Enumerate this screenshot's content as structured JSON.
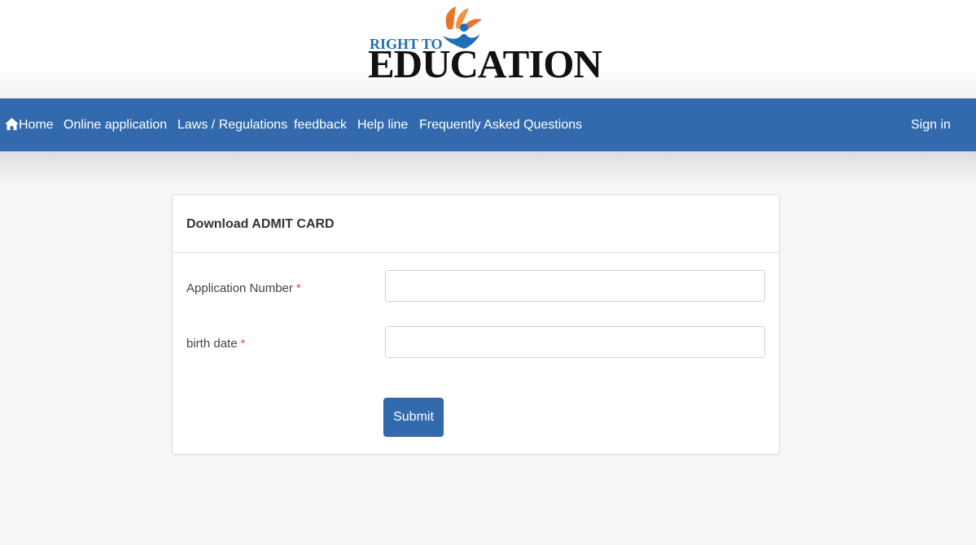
{
  "logo": {
    "line1": "RIGHT TO",
    "line2": "EDUCATION",
    "colors": {
      "blue": "#1f6fb8",
      "orange": "#e8742a",
      "black": "#111111"
    }
  },
  "nav": {
    "items": [
      {
        "label": "Home",
        "icon": "home-icon"
      },
      {
        "label": "Online application"
      },
      {
        "label": "Laws / Regulations"
      },
      {
        "label": "feedback"
      },
      {
        "label": "Help line"
      },
      {
        "label": "Frequently Asked Questions"
      }
    ],
    "sign_in": "Sign in",
    "color": "#336aad"
  },
  "form": {
    "title": "Download ADMIT CARD",
    "fields": [
      {
        "label": "Application Number",
        "required_mark": "*",
        "value": "",
        "placeholder": ""
      },
      {
        "label": "birth date",
        "required_mark": "*",
        "value": "",
        "placeholder": ""
      }
    ],
    "submit_label": "Submit"
  }
}
